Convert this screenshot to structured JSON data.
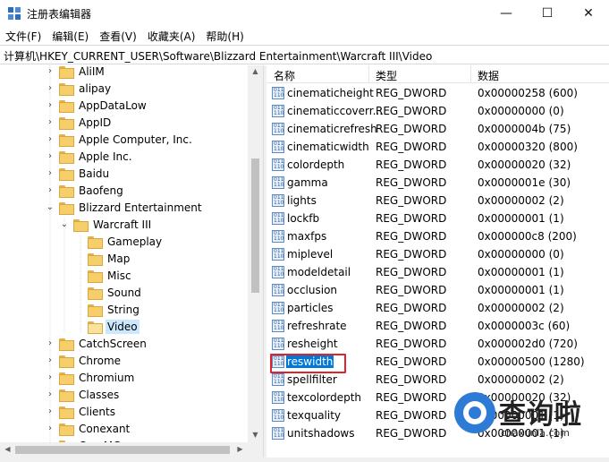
{
  "window": {
    "title": "注册表编辑器",
    "minimize": "—",
    "maximize": "☐",
    "close": "✕"
  },
  "menu": [
    "文件(F)",
    "编辑(E)",
    "查看(V)",
    "收藏夹(A)",
    "帮助(H)"
  ],
  "address": "计算机\\HKEY_CURRENT_USER\\Software\\Blizzard Entertainment\\Warcraft III\\Video",
  "tree": {
    "items": [
      {
        "label": "AliIM",
        "depth": 0,
        "expanded": false,
        "selected": false
      },
      {
        "label": "alipay",
        "depth": 0,
        "expanded": false,
        "selected": false
      },
      {
        "label": "AppDataLow",
        "depth": 0,
        "expanded": false,
        "selected": false
      },
      {
        "label": "AppID",
        "depth": 0,
        "expanded": false,
        "selected": false
      },
      {
        "label": "Apple Computer, Inc.",
        "depth": 0,
        "expanded": false,
        "selected": false
      },
      {
        "label": "Apple Inc.",
        "depth": 0,
        "expanded": false,
        "selected": false
      },
      {
        "label": "Baidu",
        "depth": 0,
        "expanded": false,
        "selected": false
      },
      {
        "label": "Baofeng",
        "depth": 0,
        "expanded": false,
        "selected": false
      },
      {
        "label": "Blizzard Entertainment",
        "depth": 0,
        "expanded": true,
        "selected": false
      },
      {
        "label": "Warcraft III",
        "depth": 1,
        "expanded": true,
        "selected": false
      },
      {
        "label": "Gameplay",
        "depth": 2,
        "expanded": null,
        "selected": false
      },
      {
        "label": "Map",
        "depth": 2,
        "expanded": null,
        "selected": false
      },
      {
        "label": "Misc",
        "depth": 2,
        "expanded": null,
        "selected": false
      },
      {
        "label": "Sound",
        "depth": 2,
        "expanded": null,
        "selected": false
      },
      {
        "label": "String",
        "depth": 2,
        "expanded": null,
        "selected": false
      },
      {
        "label": "Video",
        "depth": 2,
        "expanded": null,
        "selected": true
      },
      {
        "label": "CatchScreen",
        "depth": 0,
        "expanded": false,
        "selected": false
      },
      {
        "label": "Chrome",
        "depth": 0,
        "expanded": false,
        "selected": false
      },
      {
        "label": "Chromium",
        "depth": 0,
        "expanded": false,
        "selected": false
      },
      {
        "label": "Classes",
        "depth": 0,
        "expanded": false,
        "selected": false
      },
      {
        "label": "Clients",
        "depth": 0,
        "expanded": false,
        "selected": false
      },
      {
        "label": "Conexant",
        "depth": 0,
        "expanded": false,
        "selected": false
      },
      {
        "label": "CoreMG",
        "depth": 0,
        "expanded": false,
        "selected": false
      }
    ]
  },
  "list": {
    "headers": {
      "name": "名称",
      "type": "类型",
      "data": "数据"
    },
    "rows": [
      {
        "name": "cinematicheight",
        "type": "REG_DWORD",
        "data": "0x00000258 (600)"
      },
      {
        "name": "cinematiccoverr...",
        "type": "REG_DWORD",
        "data": "0x00000000 (0)"
      },
      {
        "name": "cinematicrefresh",
        "type": "REG_DWORD",
        "data": "0x0000004b (75)"
      },
      {
        "name": "cinematicwidth",
        "type": "REG_DWORD",
        "data": "0x00000320 (800)"
      },
      {
        "name": "colordepth",
        "type": "REG_DWORD",
        "data": "0x00000020 (32)"
      },
      {
        "name": "gamma",
        "type": "REG_DWORD",
        "data": "0x0000001e (30)"
      },
      {
        "name": "lights",
        "type": "REG_DWORD",
        "data": "0x00000002 (2)"
      },
      {
        "name": "lockfb",
        "type": "REG_DWORD",
        "data": "0x00000001 (1)"
      },
      {
        "name": "maxfps",
        "type": "REG_DWORD",
        "data": "0x000000c8 (200)"
      },
      {
        "name": "miplevel",
        "type": "REG_DWORD",
        "data": "0x00000000 (0)"
      },
      {
        "name": "modeldetail",
        "type": "REG_DWORD",
        "data": "0x00000001 (1)"
      },
      {
        "name": "occlusion",
        "type": "REG_DWORD",
        "data": "0x00000001 (1)"
      },
      {
        "name": "particles",
        "type": "REG_DWORD",
        "data": "0x00000002 (2)"
      },
      {
        "name": "refreshrate",
        "type": "REG_DWORD",
        "data": "0x0000003c (60)"
      },
      {
        "name": "resheight",
        "type": "REG_DWORD",
        "data": "0x000002d0 (720)"
      },
      {
        "name": "reswidth",
        "type": "REG_DWORD",
        "data": "0x00000500 (1280)",
        "selected": true
      },
      {
        "name": "spellfilter",
        "type": "REG_DWORD",
        "data": "0x00000002 (2)"
      },
      {
        "name": "texcolordepth",
        "type": "REG_DWORD",
        "data": "0x00000020 (32)"
      },
      {
        "name": "texquality",
        "type": "REG_DWORD",
        "data": "0x00000001 (1)"
      },
      {
        "name": "unitshadows",
        "type": "REG_DWORD",
        "data": "0x00000001 (1)"
      }
    ]
  },
  "watermark": {
    "title": "查询啦",
    "url": "chaxunla.com"
  },
  "colors": {
    "selection": "#0078d7",
    "highlight_box": "#e0232b",
    "folder": "#f6cf6a"
  }
}
